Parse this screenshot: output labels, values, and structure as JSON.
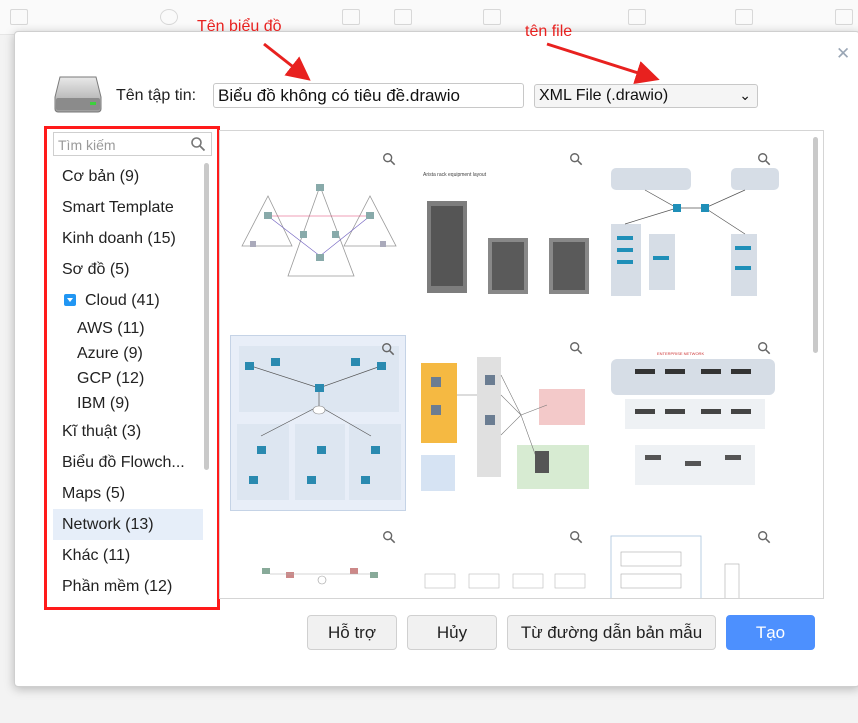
{
  "dialog": {
    "filename_label": "Tên tập tin:",
    "filename_value": "Biểu đồ không có tiêu đề.drawio",
    "format_selected": "XML File (.drawio)"
  },
  "annotations": {
    "diagram_name": "Tên biểu đồ",
    "file_name": "tên file"
  },
  "search": {
    "placeholder": "Tìm kiếm"
  },
  "categories": [
    {
      "label": "Cơ bản (9)"
    },
    {
      "label": "Smart Template"
    },
    {
      "label": "Kinh doanh (15)"
    },
    {
      "label": "Sơ đồ (5)"
    },
    {
      "label": "Cloud (41)"
    },
    {
      "label": "AWS (11)"
    },
    {
      "label": "Azure (9)"
    },
    {
      "label": "GCP (12)"
    },
    {
      "label": "IBM (9)"
    },
    {
      "label": "Kĩ thuật (3)"
    },
    {
      "label": "Biểu đồ Flowch..."
    },
    {
      "label": "Maps (5)"
    },
    {
      "label": "Network (13)"
    },
    {
      "label": "Khác (11)"
    },
    {
      "label": "Phần mềm (12)"
    }
  ],
  "selected_category": "Network (13)",
  "templates": {
    "rack_title": "Arista rack equipment layout",
    "enterprise_title": "ENTERPRISE NETWORK"
  },
  "buttons": {
    "help": "Hỗ trợ",
    "cancel": "Hủy",
    "from_url": "Từ đường dẫn bản mẫu",
    "create": "Tạo"
  },
  "colors": {
    "accent": "#4d90fe",
    "annotation": "#e8211f",
    "selection": "#e6eef9"
  }
}
